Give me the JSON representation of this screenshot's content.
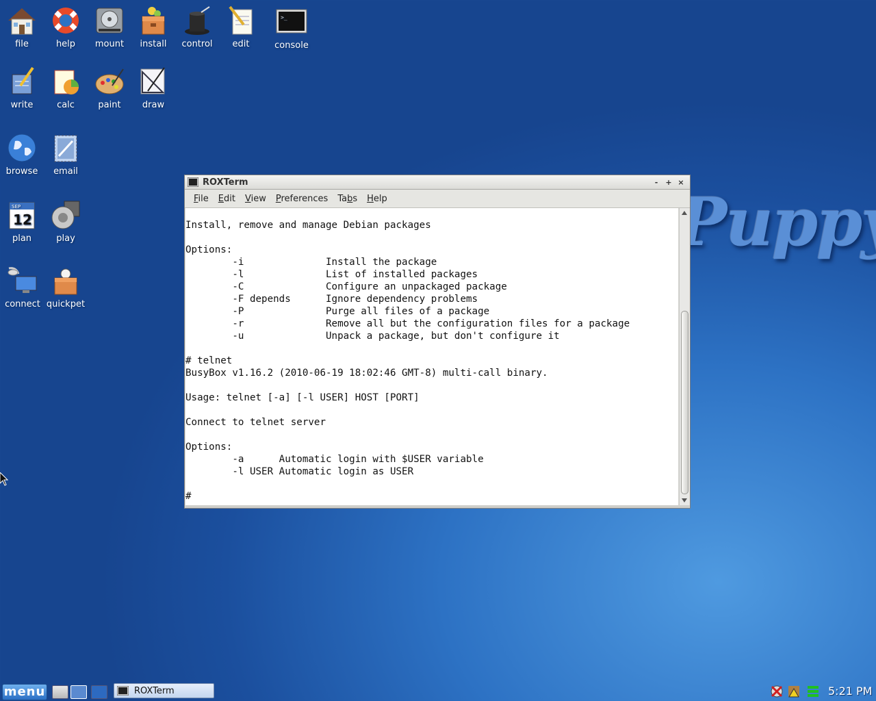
{
  "desktop": {
    "wallpaper_text": "Puppy",
    "icons": [
      {
        "name": "file",
        "label": "file"
      },
      {
        "name": "help",
        "label": "help"
      },
      {
        "name": "mount",
        "label": "mount"
      },
      {
        "name": "install",
        "label": "install"
      },
      {
        "name": "control",
        "label": "control"
      },
      {
        "name": "edit",
        "label": "edit"
      },
      {
        "name": "console",
        "label": "console"
      },
      {
        "name": "write",
        "label": "write"
      },
      {
        "name": "calc",
        "label": "calc"
      },
      {
        "name": "paint",
        "label": "paint"
      },
      {
        "name": "draw",
        "label": "draw"
      },
      {
        "name": "browse",
        "label": "browse"
      },
      {
        "name": "email",
        "label": "email"
      },
      {
        "name": "plan",
        "label": "plan",
        "calendar_day": "12",
        "calendar_month": "SEP"
      },
      {
        "name": "play",
        "label": "play"
      },
      {
        "name": "connect",
        "label": "connect"
      },
      {
        "name": "quickpet",
        "label": "quickpet"
      }
    ]
  },
  "window": {
    "title": "ROXTerm",
    "controls": {
      "minimize": "-",
      "maximize": "+",
      "close": "×"
    },
    "menu": {
      "file": {
        "pre": "",
        "ul": "F",
        "post": "ile"
      },
      "edit": {
        "pre": "",
        "ul": "E",
        "post": "dit"
      },
      "view": {
        "pre": "",
        "ul": "V",
        "post": "iew"
      },
      "preferences": {
        "pre": "",
        "ul": "P",
        "post": "references"
      },
      "tabs": {
        "pre": "Ta",
        "ul": "b",
        "post": "s"
      },
      "help": {
        "pre": "",
        "ul": "H",
        "post": "elp"
      }
    },
    "terminal_lines": [
      "Install, remove and manage Debian packages",
      "",
      "Options:",
      "        -i              Install the package",
      "        -l              List of installed packages",
      "        -C              Configure an unpackaged package",
      "        -F depends      Ignore dependency problems",
      "        -P              Purge all files of a package",
      "        -r              Remove all but the configuration files for a package",
      "        -u              Unpack a package, but don't configure it",
      "",
      "# telnet",
      "BusyBox v1.16.2 (2010-06-19 18:02:46 GMT-8) multi-call binary.",
      "",
      "Usage: telnet [-a] [-l USER] HOST [PORT]",
      "",
      "Connect to telnet server",
      "",
      "Options:",
      "        -a      Automatic login with $USER variable",
      "        -l USER Automatic login as USER",
      "",
      "#"
    ]
  },
  "taskbar": {
    "menu_label": "menu",
    "task_label": "ROXTerm",
    "clock": "5:21 PM"
  },
  "colors": {
    "desktop_blue": "#2d72c4",
    "terminal_bg": "#ffffff",
    "terminal_fg": "#111111"
  }
}
